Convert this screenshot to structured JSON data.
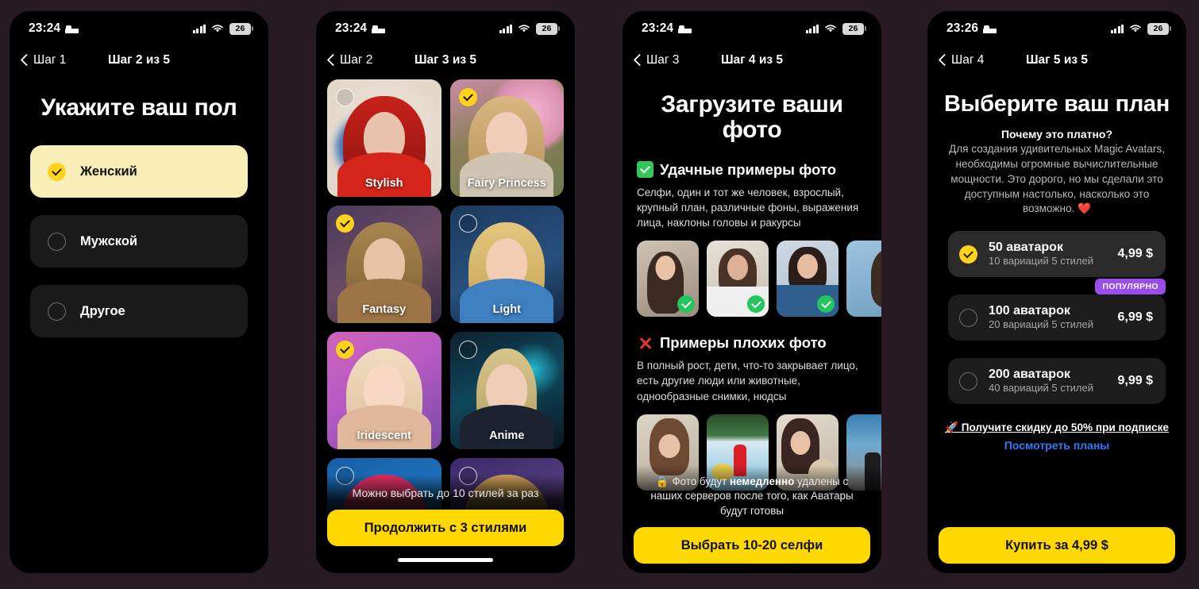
{
  "theme": {
    "page_background": "#271a22",
    "accent_yellow": "#ffd800",
    "select_yellow": "#ffd21e",
    "cream": "#f8efb8",
    "popular_purple": "#9b4deb",
    "link_blue": "#2f7bf6",
    "good_green": "#32c759",
    "bad_red": "#e8372b"
  },
  "statusbar": {
    "time_early": "23:24",
    "time_late": "23:26",
    "battery": "26",
    "icons": [
      "bed-icon",
      "signal-bars-icon",
      "wifi-icon",
      "battery-icon"
    ]
  },
  "screens": [
    {
      "id": "gender",
      "time": "23:24",
      "nav": {
        "back_label": "Шаг 1",
        "title": "Шаг 2 из 5"
      },
      "heading": "Укажите ваш пол",
      "options": [
        {
          "label": "Женский",
          "selected": true
        },
        {
          "label": "Мужской",
          "selected": false
        },
        {
          "label": "Другое",
          "selected": false
        }
      ]
    },
    {
      "id": "styles",
      "time": "23:24",
      "nav": {
        "back_label": "Шаг 2",
        "title": "Шаг 3 из 5"
      },
      "cards": [
        {
          "label": "Stylish",
          "selected": false
        },
        {
          "label": "Fairy Princess",
          "selected": true
        },
        {
          "label": "Fantasy",
          "selected": true
        },
        {
          "label": "Light",
          "selected": false
        },
        {
          "label": "Iridescent",
          "selected": true
        },
        {
          "label": "Anime",
          "selected": false
        },
        {
          "label": "",
          "selected": false
        },
        {
          "label": "",
          "selected": false
        }
      ],
      "note": "Можно выбрать до 10 стилей за раз",
      "cta": "Продолжить с 3 стилями"
    },
    {
      "id": "photos",
      "time": "23:24",
      "nav": {
        "back_label": "Шаг 3",
        "title": "Шаг 4 из 5"
      },
      "heading": "Загрузите ваши фото",
      "good": {
        "title": "Удачные примеры фото",
        "desc": "Селфи, один и тот же человек, взрослый, крупный план, различные фоны, выражения лица, наклоны головы и ракурсы"
      },
      "bad": {
        "title": "Примеры плохих фото",
        "desc": "В полный рост, дети, что-то закрывает лицо, есть другие люди или животные, однообразные снимки, нюдсы"
      },
      "privacy_pre": "Фото будут ",
      "privacy_strong": "немедленно",
      "privacy_post": " удалены с наших серверов после того, как Аватары будут готовы",
      "cta": "Выбрать 10-20 селфи"
    },
    {
      "id": "plans",
      "time": "23:26",
      "nav": {
        "back_label": "Шаг 4",
        "title": "Шаг 5 из 5"
      },
      "heading": "Выберите ваш план",
      "why_title": "Почему это платно?",
      "why_body": "Для создания удивительных Magic Avatars, необходимы огромные вычислительные мощности. Это дорого, но мы сделали это доступным настолько, насколько это возможно. ❤️",
      "plans": [
        {
          "name": "50 аватарок",
          "sub": "10 вариаций 5 стилей",
          "price": "4,99 $",
          "selected": true,
          "badge": ""
        },
        {
          "name": "100 аватарок",
          "sub": "20 вариаций 5 стилей",
          "price": "6,99 $",
          "selected": false,
          "badge": "ПОПУЛЯРНО"
        },
        {
          "name": "200 аватарок",
          "sub": "40 вариаций 5 стилей",
          "price": "9,99 $",
          "selected": false,
          "badge": ""
        }
      ],
      "promo": "🚀 Получите скидку до 50% при подписке",
      "promo_link": "Посмотреть планы",
      "cta": "Купить за 4,99 $"
    }
  ]
}
